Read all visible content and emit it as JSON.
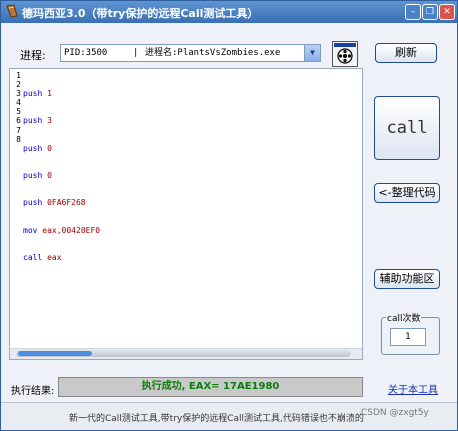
{
  "window": {
    "title": "德玛西亚3.0（带try保护的远程Call测试工具）",
    "min_glyph": "–",
    "max_glyph": "❐",
    "close_glyph": "✕"
  },
  "process": {
    "label": "进程:",
    "pid": "PID:3500",
    "separator": "|",
    "name_label": "进程名:PlantsVsZombies.exe",
    "dropdown_icon": "▼"
  },
  "buttons": {
    "refresh": "刷新",
    "call": "call",
    "organize": "<-整理代码",
    "assist": "辅助功能区"
  },
  "editor": {
    "line_numbers": [
      "1",
      "2",
      "3",
      "4",
      "5",
      "6",
      "7",
      "8"
    ],
    "lines": [
      {
        "op": "push",
        "arg": "1"
      },
      {
        "op": "push",
        "arg": "3"
      },
      {
        "op": "push",
        "arg": "0"
      },
      {
        "op": "push",
        "arg": "0"
      },
      {
        "op": "push",
        "arg": "0FA6F268"
      },
      {
        "op": "mov",
        "arg": "eax,00420EF0"
      },
      {
        "op": "call",
        "arg": "eax"
      },
      {
        "op": "",
        "arg": ""
      }
    ]
  },
  "call_count": {
    "title": "call次数",
    "value": "1"
  },
  "result": {
    "label": "执行结果:",
    "text": "执行成功, EAX= 17AE1980"
  },
  "about": "关于本工具",
  "status": "新一代的Call测试工具,带try保护的远程Call测试工具,代码错误也不崩溃的",
  "watermark": "CSDN @zxgt5y",
  "colors": {
    "titlebar": "#3a6fb4",
    "op": "#0000cc",
    "arg": "#a00000",
    "success": "#0a7d0a",
    "link": "#1a33b5"
  }
}
